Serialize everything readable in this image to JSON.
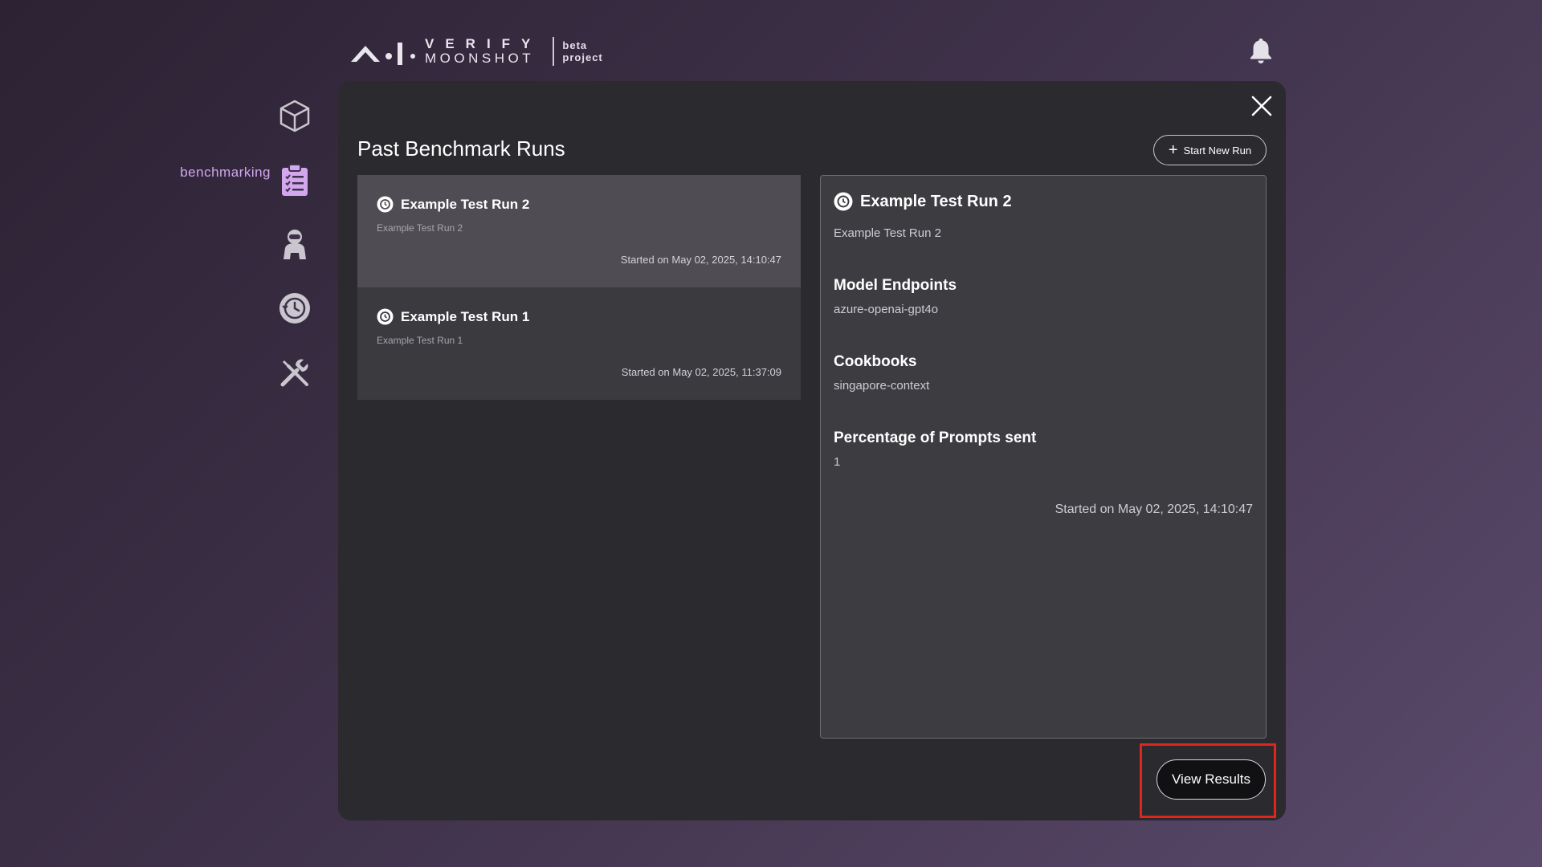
{
  "header": {
    "logo_word1": "VERIFY",
    "logo_word2": "MOONSHOT",
    "badge_line1": "beta",
    "badge_line2": "project"
  },
  "sidebar": {
    "active_label": "benchmarking",
    "items": [
      {
        "icon": "cube-icon"
      },
      {
        "icon": "clipboard-list-icon",
        "label": "benchmarking"
      },
      {
        "icon": "red-teaming-icon"
      },
      {
        "icon": "history-icon"
      },
      {
        "icon": "tools-icon"
      }
    ]
  },
  "modal": {
    "title": "Past Benchmark Runs",
    "start_button": "Start New Run",
    "runs": [
      {
        "name": "Example Test Run 2",
        "description": "Example Test Run 2",
        "started": "Started on May 02, 2025, 14:10:47",
        "selected": true
      },
      {
        "name": "Example Test Run 1",
        "description": "Example Test Run 1",
        "started": "Started on May 02, 2025, 11:37:09",
        "selected": false
      }
    ],
    "detail": {
      "name": "Example Test Run 2",
      "description": "Example Test Run 2",
      "endpoints_heading": "Model Endpoints",
      "endpoints_value": "azure-openai-gpt4o",
      "cookbooks_heading": "Cookbooks",
      "cookbooks_value": "singapore-context",
      "prompts_heading": "Percentage of Prompts sent",
      "prompts_value": "1",
      "started": "Started on May 02, 2025, 14:10:47"
    },
    "view_results_button": "View Results"
  },
  "colors": {
    "accent_label": "#d2a7ee",
    "highlight": "#e0251c",
    "modal_bg": "#2b2a2e",
    "selected_card": "#4f4d53"
  }
}
